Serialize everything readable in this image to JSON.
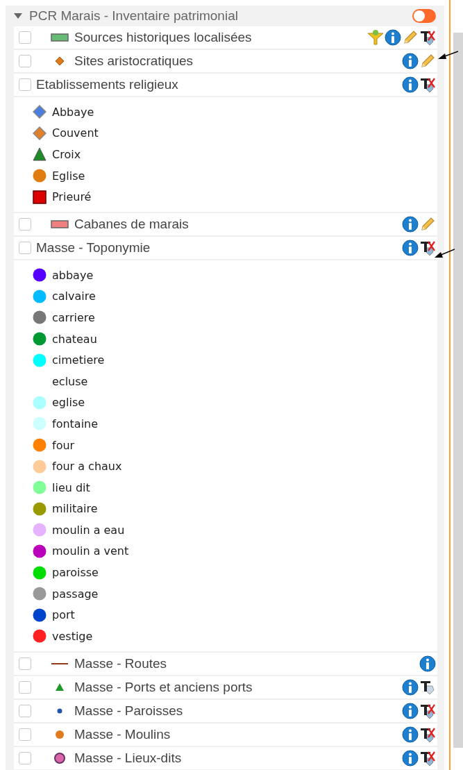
{
  "group": {
    "title": "PCR Marais - Inventaire patrimonial",
    "expanded": true,
    "on": false
  },
  "layers": [
    {
      "label": "Sources historiques localisées",
      "checked": false,
      "symbol": {
        "kind": "rect",
        "color": "#66bb77"
      },
      "tools": [
        {
          "kind": "filter"
        },
        {
          "kind": "info"
        },
        {
          "kind": "edit"
        },
        {
          "kind": "labels_off"
        }
      ]
    },
    {
      "label": "Sites aristocratiques",
      "checked": false,
      "symbol": {
        "kind": "small_diamond",
        "color": "#e07a1f"
      },
      "tools": [
        {
          "kind": "info"
        },
        {
          "kind": "edit"
        }
      ]
    },
    {
      "label": "Etablissements religieux",
      "checked": false,
      "tools": [
        {
          "kind": "info"
        },
        {
          "kind": "labels_off"
        }
      ],
      "legend": [
        {
          "label": "Abbaye",
          "kind": "diamond",
          "color": "#4a7fe0"
        },
        {
          "label": "Couvent",
          "kind": "diamond",
          "color": "#e0802a"
        },
        {
          "label": "Croix",
          "kind": "triangle",
          "color": "#1f8a2a"
        },
        {
          "label": "Eglise",
          "kind": "circle",
          "color": "#e07d10"
        },
        {
          "label": "Prieuré",
          "kind": "square",
          "color": "#dd0000"
        }
      ]
    },
    {
      "label": "Cabanes de marais",
      "checked": false,
      "symbol": {
        "kind": "rect",
        "color": "#f08080"
      },
      "tools": [
        {
          "kind": "info"
        },
        {
          "kind": "edit"
        }
      ]
    },
    {
      "label": "Masse - Toponymie",
      "checked": false,
      "tools": [
        {
          "kind": "info"
        },
        {
          "kind": "labels_off"
        }
      ],
      "legend": [
        {
          "label": "abbaye",
          "kind": "circle",
          "color": "#5500ff"
        },
        {
          "label": "calvaire",
          "kind": "circle",
          "color": "#00bbff"
        },
        {
          "label": "carriere",
          "kind": "circle",
          "color": "#777777"
        },
        {
          "label": "chateau",
          "kind": "circle",
          "color": "#009933"
        },
        {
          "label": "cimetiere",
          "kind": "circle",
          "color": "#00ffff"
        },
        {
          "label": "ecluse",
          "kind": "none"
        },
        {
          "label": "eglise",
          "kind": "circle",
          "color": "#aaffff"
        },
        {
          "label": "fontaine",
          "kind": "circle",
          "color": "#ccffff"
        },
        {
          "label": "four",
          "kind": "circle",
          "color": "#ff8000"
        },
        {
          "label": "four a chaux",
          "kind": "circle",
          "color": "#ffcc99"
        },
        {
          "label": "lieu dit",
          "kind": "circle",
          "color": "#80ff99"
        },
        {
          "label": "militaire",
          "kind": "circle",
          "color": "#999900"
        },
        {
          "label": "moulin a eau",
          "kind": "circle",
          "color": "#e6b3ff"
        },
        {
          "label": "moulin a vent",
          "kind": "circle",
          "color": "#bb00bb"
        },
        {
          "label": "paroisse",
          "kind": "circle",
          "color": "#00dd00"
        },
        {
          "label": "passage",
          "kind": "circle",
          "color": "#999999"
        },
        {
          "label": "port",
          "kind": "circle",
          "color": "#0044cc"
        },
        {
          "label": "vestige",
          "kind": "circle",
          "color": "#ff2222"
        }
      ]
    },
    {
      "label": "Masse - Routes",
      "checked": false,
      "symbol": {
        "kind": "line",
        "color": "#8b3a1a"
      },
      "tools": [
        {
          "kind": "info"
        }
      ]
    },
    {
      "label": "Masse - Ports et anciens ports",
      "checked": false,
      "symbol": {
        "kind": "triangle",
        "color": "#1f9a2a"
      },
      "tools": [
        {
          "kind": "info"
        },
        {
          "kind": "labels"
        }
      ]
    },
    {
      "label": "Masse - Paroisses",
      "checked": false,
      "symbol": {
        "kind": "dot",
        "color": "#2255aa"
      },
      "tools": [
        {
          "kind": "info"
        },
        {
          "kind": "labels_off"
        }
      ]
    },
    {
      "label": "Masse - Moulins",
      "checked": false,
      "symbol": {
        "kind": "blob",
        "color": "#e07a1f"
      },
      "tools": [
        {
          "kind": "info"
        },
        {
          "kind": "labels_off"
        }
      ]
    },
    {
      "label": "Masse - Lieux-dits",
      "checked": false,
      "symbol": {
        "kind": "ring",
        "color": "#dd66aa"
      },
      "tools": [
        {
          "kind": "info"
        },
        {
          "kind": "labels_off"
        }
      ]
    }
  ]
}
